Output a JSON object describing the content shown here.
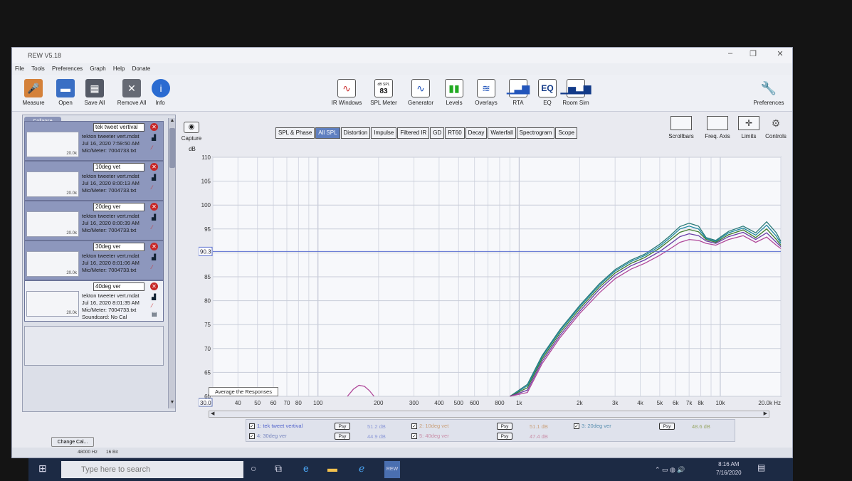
{
  "window": {
    "title": "REW V5.18",
    "controls": [
      "–",
      "❐",
      "✕"
    ]
  },
  "menu": [
    "File",
    "Tools",
    "Preferences",
    "Graph",
    "Help",
    "Donate"
  ],
  "toolbar_left": [
    {
      "label": "Measure",
      "icon": "microphone-icon",
      "color": "#d4813a"
    },
    {
      "label": "Open",
      "icon": "folder-icon",
      "color": "#3a6fc4"
    },
    {
      "label": "Save All",
      "icon": "save-icon",
      "color": "#555a66"
    },
    {
      "label": "Remove All",
      "icon": "remove-all-icon",
      "color": "#666a74"
    },
    {
      "label": "Info",
      "icon": "info-icon",
      "color": "#2a6bd1"
    }
  ],
  "toolbar_center": [
    {
      "label": "IR Windows",
      "icon": "ir-windows-icon"
    },
    {
      "label": "SPL Meter",
      "icon": "spl-meter-icon",
      "value": "83",
      "caption": "dB SPL"
    },
    {
      "label": "Generator",
      "icon": "generator-icon"
    },
    {
      "label": "Levels",
      "icon": "levels-icon"
    },
    {
      "label": "Overlays",
      "icon": "overlays-icon"
    },
    {
      "label": "RTA",
      "icon": "rta-icon"
    },
    {
      "label": "EQ",
      "icon": "eq-icon",
      "value": "EQ"
    },
    {
      "label": "Room Sim",
      "icon": "room-sim-icon"
    }
  ],
  "preferences_label": "Preferences",
  "right_tools": [
    {
      "label": "Scrollbars",
      "icon": "scrollbars-icon"
    },
    {
      "label": "Freq. Axis",
      "icon": "freq-axis-icon"
    },
    {
      "label": "Limits",
      "icon": "limits-icon"
    },
    {
      "label": "Controls",
      "icon": "controls-icon"
    }
  ],
  "collapse_label": "Collapse",
  "measurements": [
    {
      "name": "tek tweet vertival",
      "file": "tekton tweeter vert.mdat",
      "date": "Jul 16, 2020 7:59:50 AM",
      "mic": "Mic/Meter: 7004733.txt",
      "scale": "20.0k"
    },
    {
      "name": "10deg vet",
      "file": "tekton tweeter vert.mdat",
      "date": "Jul 16, 2020 8:00:13 AM",
      "mic": "Mic/Meter: 7004733.txt",
      "scale": "20.0k"
    },
    {
      "name": "20deg ver",
      "file": "tekton tweeter vert.mdat",
      "date": "Jul 16, 2020 8:00:39 AM",
      "mic": "Mic/Meter: 7004733.txt",
      "scale": "20.0k"
    },
    {
      "name": "30deg ver",
      "file": "tekton tweeter vert.mdat",
      "date": "Jul 16, 2020 8:01:06 AM",
      "mic": "Mic/Meter: 7004733.txt",
      "scale": "20.0k"
    },
    {
      "name": "40deg ver",
      "file": "tekton tweeter vert.mdat",
      "date": "Jul 16, 2020 8:01:35 AM",
      "mic": "Mic/Meter: 7004733.txt",
      "soundcard": "Soundcard: No Cal",
      "scale": "20.0k"
    }
  ],
  "change_cal_label": "Change Cal...",
  "capture_label": "Capture",
  "tabs": [
    "SPL & Phase",
    "All SPL",
    "Distortion",
    "Impulse",
    "Filtered IR",
    "GD",
    "RT60",
    "Decay",
    "Waterfall",
    "Spectrogram",
    "Scope"
  ],
  "active_tab": "All SPL",
  "y_unit": "dB",
  "graph_overlay_text": "Average the Responses",
  "cursor_value": "90.3",
  "x_min_field": "30.0",
  "legend": [
    {
      "idx": "1",
      "name": "tek tweet vertival",
      "psy": "Psy",
      "level": "51.2 dB"
    },
    {
      "idx": "2",
      "name": "10deg vet",
      "psy": "Psy",
      "level": "51.1 dB"
    },
    {
      "idx": "3",
      "name": "20deg ver",
      "psy": "Psy",
      "level": "48.6 dB"
    },
    {
      "idx": "4",
      "name": "30deg ver",
      "psy": "Psy",
      "level": "44.9 dB"
    },
    {
      "idx": "5",
      "name": "40deg ver",
      "psy": "Psy",
      "level": "47.4 dB"
    }
  ],
  "status": {
    "rate": "48000 Hz",
    "bits": "16 Bit"
  },
  "taskbar": {
    "search_placeholder": "Type here to search",
    "time": "8:16 AM",
    "date": "7/16/2020"
  },
  "chart_data": {
    "type": "line",
    "xlabel": "",
    "ylabel": "dB",
    "x_scale": "log",
    "xlim": [
      30,
      20000
    ],
    "ylim": [
      60,
      110
    ],
    "x_ticks": [
      {
        "v": 30,
        "l": "30.0"
      },
      {
        "v": 40,
        "l": "40"
      },
      {
        "v": 50,
        "l": "50"
      },
      {
        "v": 60,
        "l": "60"
      },
      {
        "v": 70,
        "l": "70"
      },
      {
        "v": 80,
        "l": "80"
      },
      {
        "v": 100,
        "l": "100"
      },
      {
        "v": 200,
        "l": "200"
      },
      {
        "v": 300,
        "l": "300"
      },
      {
        "v": 400,
        "l": "400"
      },
      {
        "v": 500,
        "l": "500"
      },
      {
        "v": 600,
        "l": "600"
      },
      {
        "v": 800,
        "l": "800"
      },
      {
        "v": 1000,
        "l": "1k"
      },
      {
        "v": 2000,
        "l": "2k"
      },
      {
        "v": 3000,
        "l": "3k"
      },
      {
        "v": 4000,
        "l": "4k"
      },
      {
        "v": 5000,
        "l": "5k"
      },
      {
        "v": 6000,
        "l": "6k"
      },
      {
        "v": 7000,
        "l": "7k"
      },
      {
        "v": 8000,
        "l": "8k"
      },
      {
        "v": 10000,
        "l": "10k"
      },
      {
        "v": 20000,
        "l": "20.0k Hz"
      }
    ],
    "y_ticks": [
      110,
      105,
      100,
      95,
      90,
      85,
      80,
      75,
      70,
      65,
      60
    ],
    "grid": true,
    "series": [
      {
        "name": "tek tweet vertival",
        "color": "#2b7a78",
        "x": [
          900,
          1100,
          1300,
          1600,
          2000,
          2500,
          3000,
          3600,
          4200,
          5000,
          5600,
          6300,
          7000,
          7800,
          8500,
          9500,
          11000,
          13000,
          15000,
          17000,
          19000,
          20000
        ],
        "y": [
          60,
          62.5,
          68.5,
          74,
          79,
          83.5,
          86.5,
          88.5,
          89.7,
          91.8,
          93.5,
          95.5,
          96.2,
          95.6,
          93.2,
          92.6,
          94.5,
          95.6,
          94.2,
          96.5,
          94.2,
          92.4
        ]
      },
      {
        "name": "10deg vet",
        "color": "#1f8aa0",
        "x": [
          900,
          1100,
          1300,
          1600,
          2000,
          2500,
          3000,
          3600,
          4200,
          5000,
          5600,
          6300,
          7000,
          7800,
          8500,
          9500,
          11000,
          13000,
          15000,
          17000,
          19000,
          20000
        ],
        "y": [
          60,
          62.2,
          68.2,
          73.7,
          78.7,
          83.2,
          86.2,
          88.2,
          89.4,
          91.4,
          93.1,
          95.0,
          95.6,
          95.0,
          93.0,
          92.4,
          94.2,
          95.2,
          93.7,
          95.8,
          93.5,
          92.0
        ]
      },
      {
        "name": "20deg ver",
        "color": "#3f7a2c",
        "x": [
          900,
          1100,
          1300,
          1600,
          2000,
          2500,
          3000,
          3600,
          4200,
          5000,
          5600,
          6300,
          7000,
          7800,
          8500,
          9500,
          11000,
          13000,
          15000,
          17000,
          19000,
          20000
        ],
        "y": [
          60,
          61.8,
          67.8,
          73.3,
          78.3,
          82.8,
          85.8,
          87.8,
          89.0,
          91.0,
          92.6,
          94.3,
          94.9,
          94.4,
          92.8,
          92.2,
          93.8,
          94.8,
          93.2,
          95.0,
          92.8,
          91.6
        ]
      },
      {
        "name": "30deg ver",
        "color": "#6a3fa6",
        "x": [
          900,
          1100,
          1300,
          1600,
          2000,
          2500,
          3000,
          3600,
          4200,
          5000,
          5600,
          6300,
          7000,
          7800,
          8500,
          9500,
          11000,
          13000,
          15000,
          17000,
          19000,
          20000
        ],
        "y": [
          60,
          61.3,
          67.3,
          72.8,
          77.8,
          82.3,
          85.3,
          87.3,
          88.5,
          90.3,
          91.8,
          93.4,
          94.0,
          93.6,
          92.5,
          92.0,
          93.4,
          94.3,
          92.8,
          94.2,
          92.2,
          91.3
        ]
      },
      {
        "name": "40deg ver",
        "color": "#b0489a",
        "x": [
          900,
          1100,
          1300,
          1600,
          2000,
          2500,
          3000,
          3600,
          4200,
          5000,
          5600,
          6300,
          7000,
          7800,
          8500,
          9500,
          11000,
          13000,
          15000,
          17000,
          19000,
          20000
        ],
        "y": [
          60,
          60.8,
          66.8,
          72.3,
          77.3,
          81.6,
          84.6,
          86.6,
          87.8,
          89.5,
          90.8,
          92.2,
          92.8,
          92.6,
          92.0,
          91.6,
          92.8,
          93.6,
          92.2,
          93.3,
          91.6,
          90.9
        ]
      },
      {
        "name": "",
        "color": "#b0489a",
        "x": [
          140,
          150,
          160,
          170,
          180,
          190
        ],
        "y": [
          60,
          61.5,
          62.3,
          62.1,
          61.2,
          60
        ]
      }
    ]
  }
}
